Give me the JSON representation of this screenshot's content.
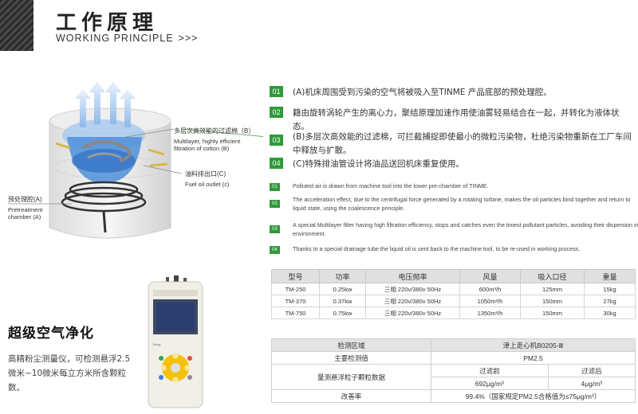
{
  "header": {
    "title_cn": "工作原理",
    "title_en": "WORKING PRINCIPLE",
    "chevrons": ">>>"
  },
  "illustration": {
    "filter_label_cn": "多层次高效能的过滤棉（B）",
    "filter_label_en_1": "Multilayer, highly efficient",
    "filter_label_en_2": "filtration of cotton (B)",
    "oil_label_cn": "油料排出口(C)",
    "oil_label_en": "Fuel oil outlet (c)",
    "pre_label_cn": "预处理腔(A)",
    "pre_label_en_1": "Pretreatment",
    "pre_label_en_2": "chamber (A)"
  },
  "steps_cn": [
    {
      "num": "01",
      "text": "(A)机床周围受到污染的空气将被吸入至TINME 产品底部的预处理腔。"
    },
    {
      "num": "02",
      "text": "籍由旋转涡轮产生的离心力，聚结原理加速作用使油雾轻易结合在一起，并转化为液体状态。"
    },
    {
      "num": "03",
      "text": "(B)多层次高效能的过滤棉，可拦截捕捉即使最小的微粒污染物，杜绝污染物重新在工厂车间中释放与扩散。"
    },
    {
      "num": "04",
      "text": "(C)特殊排油管设计将油品送回机床重复使用。"
    }
  ],
  "steps_en": [
    {
      "num": "01",
      "text": "Polluted air is drawn from machine tool into the lower pre-chamber of TINME."
    },
    {
      "num": "02",
      "text": "The acceleration effect, due to the centrifugal force generated by a rotating turbine, makes the oil particles bind together and return to liquid state, using the coalescence principle."
    },
    {
      "num": "03",
      "text": "A special Multilayer filter having high filtration efficiency, stops and catches even the tiniest pollutant particles, avoiding their dispersion in environment."
    },
    {
      "num": "04",
      "text": "Thanks to a special drainage tube the liquid oil is sent back to the machine tool, to be re-used in working process."
    }
  ],
  "spec_table": {
    "headers": [
      "型号",
      "功率",
      "电压频率",
      "风量",
      "吸入口径",
      "重量"
    ],
    "rows": [
      [
        "TM-250",
        "0.25kw",
        "三相 220v/380v 50Hz",
        "600m³/h",
        "125mm",
        "15kg"
      ],
      [
        "TM-370",
        "0.37kw",
        "三相 220v/380v 50Hz",
        "1050m³/h",
        "150mm",
        "27kg"
      ],
      [
        "TM-750",
        "0.75kw",
        "三相 220v/380v 50Hz",
        "1350m³/h",
        "150mm",
        "30kg"
      ]
    ]
  },
  "meas_table": {
    "area_label": "检测区域",
    "area_value": "津上走心机B0205-Ⅲ",
    "main_label": "主要检测值",
    "main_value": "PM2.5",
    "count_label": "量测悬浮粒子颗粒数据",
    "before_label": "过滤前",
    "after_label": "过滤后",
    "before_value": "692μg/m³",
    "after_value": "4μg/m³",
    "rate_label": "改善率",
    "rate_value": "99.4%（国家规定PM2.5合格值为≤75μg/m³）"
  },
  "air": {
    "title": "超级空气净化",
    "desc": "高精粉尘测量仪，可检测悬浮2.5微米~10微米每立方米所含颗粒数。"
  },
  "device": {
    "brand": "Bring"
  },
  "colors": {
    "accent": "#2e9a3a",
    "header_grey": "#e0e0e0",
    "ice_blue": "#4d8fd8"
  }
}
